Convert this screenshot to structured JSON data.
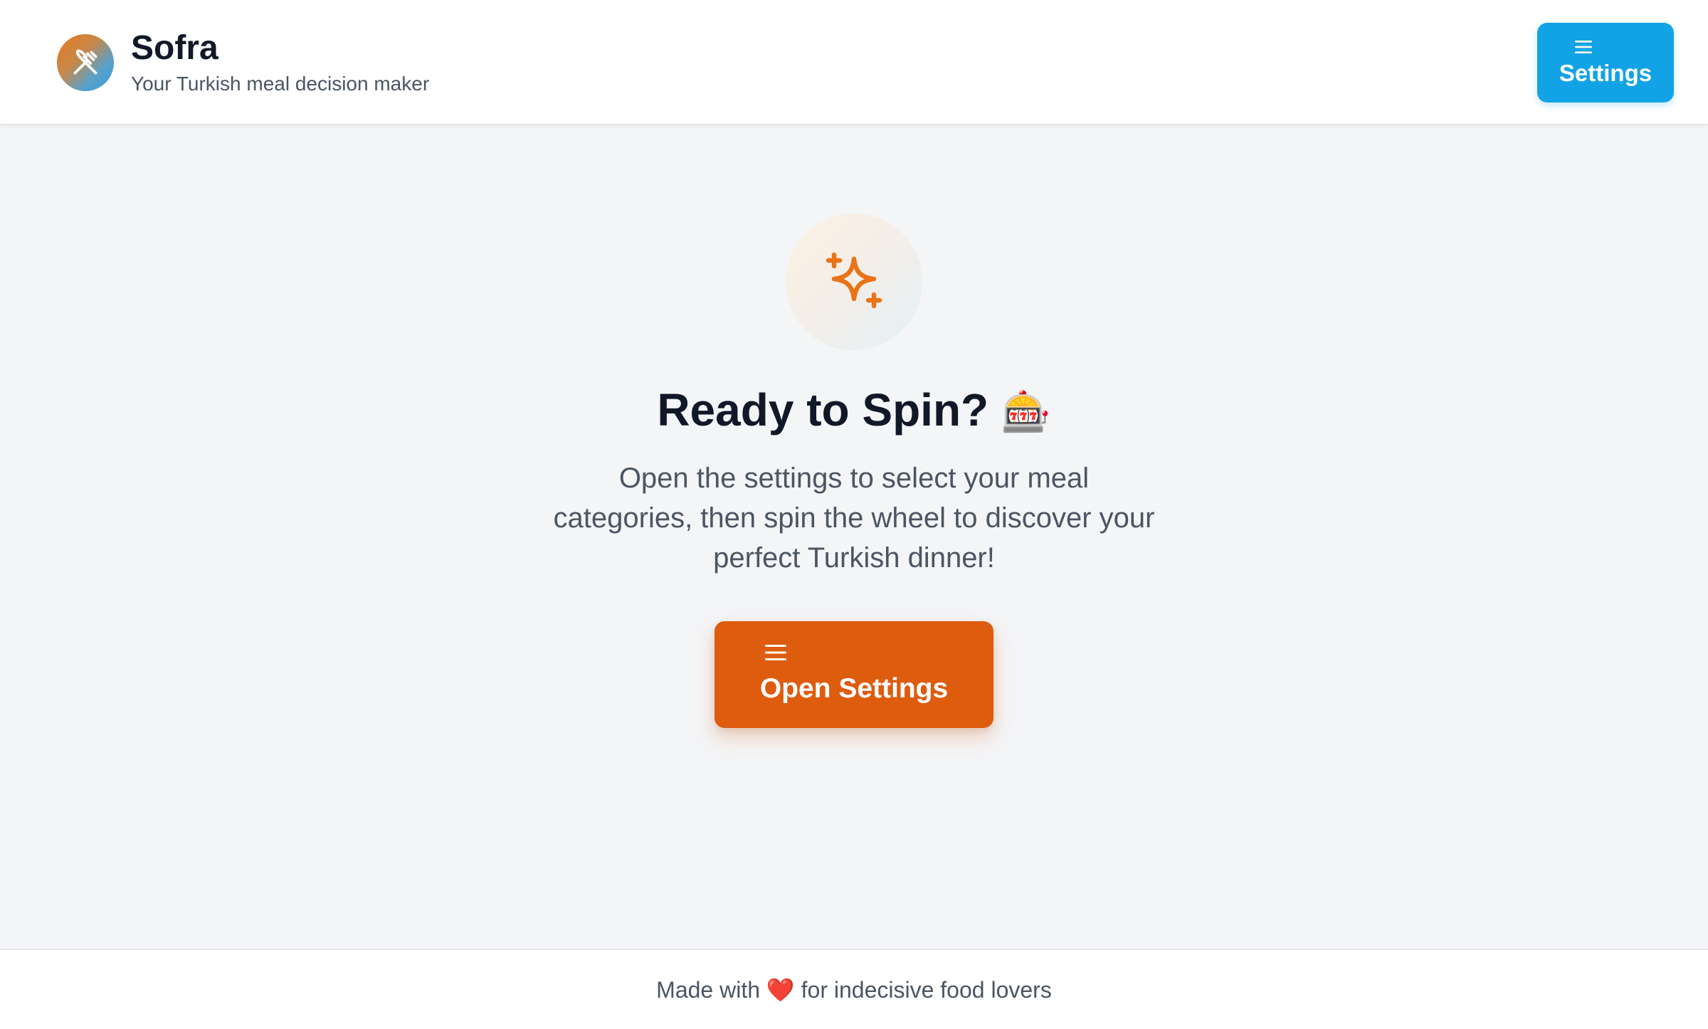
{
  "header": {
    "logo_icon": "fork-knife-icon",
    "title": "Sofra",
    "subtitle": "Your Turkish meal decision maker",
    "settings_button": {
      "icon": "menu-icon",
      "label": "Settings"
    }
  },
  "main": {
    "hero_icon": "sparkles-icon",
    "headline": "Ready to Spin?",
    "headline_emoji": "🎰",
    "description": "Open the settings to select your meal categories, then spin the wheel to discover your perfect Turkish dinner!",
    "open_button": {
      "icon": "menu-icon",
      "label": "Open Settings"
    }
  },
  "footer": {
    "text_before": "Made with",
    "heart": "❤️",
    "text_after": "for indecisive food lovers"
  },
  "colors": {
    "primary_blue": "#12a3e6",
    "accent_orange": "#de5c0e",
    "icon_orange": "#ea7317",
    "background": "#f4f5f7",
    "text_dark": "#111827",
    "text_muted": "#4b5563"
  }
}
